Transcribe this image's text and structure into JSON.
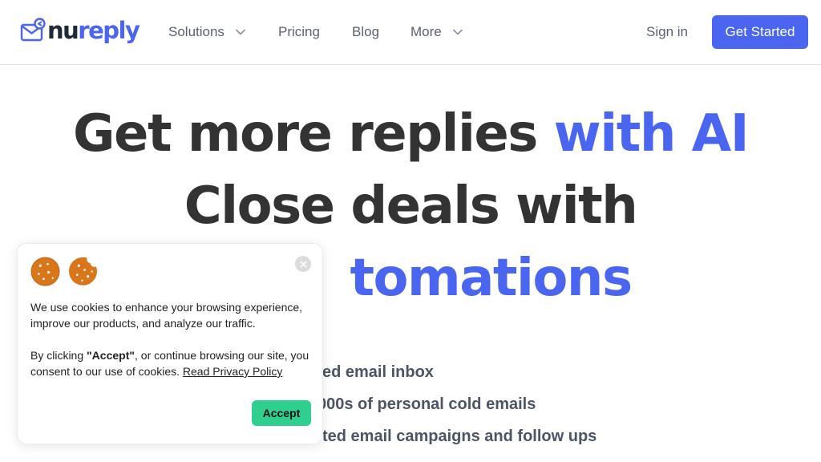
{
  "header": {
    "logo": {
      "part1": "nu",
      "part2": "reply"
    },
    "nav": {
      "solutions": "Solutions",
      "pricing": "Pricing",
      "blog": "Blog",
      "more": "More"
    },
    "sign_in": "Sign in",
    "get_started": "Get Started"
  },
  "hero": {
    "line1_dark": "Get more replies ",
    "line1_accent": "with AI",
    "line2": "Close deals with",
    "line3_accent": "tomations"
  },
  "features": [
    "ed email inbox",
    "000s of personal cold emails",
    "ted email campaigns and follow ups"
  ],
  "cookie_banner": {
    "paragraph1": "We use cookies to enhance your browsing experience, improve our products, and analyze our traffic.",
    "paragraph2_prefix": "By clicking ",
    "paragraph2_bold": "\"Accept\"",
    "paragraph2_middle": ", or continue browsing our site, you consent to our use of cookies. ",
    "privacy_link": "Read Privacy Policy",
    "accept": "Accept",
    "icons": [
      "cookie-icon",
      "bitten-cookie-icon",
      "close-icon"
    ]
  },
  "colors": {
    "brand": "#4a65f0",
    "heading": "#333333",
    "accept_button": "#2fd08f",
    "cookie": "#d9761a"
  }
}
